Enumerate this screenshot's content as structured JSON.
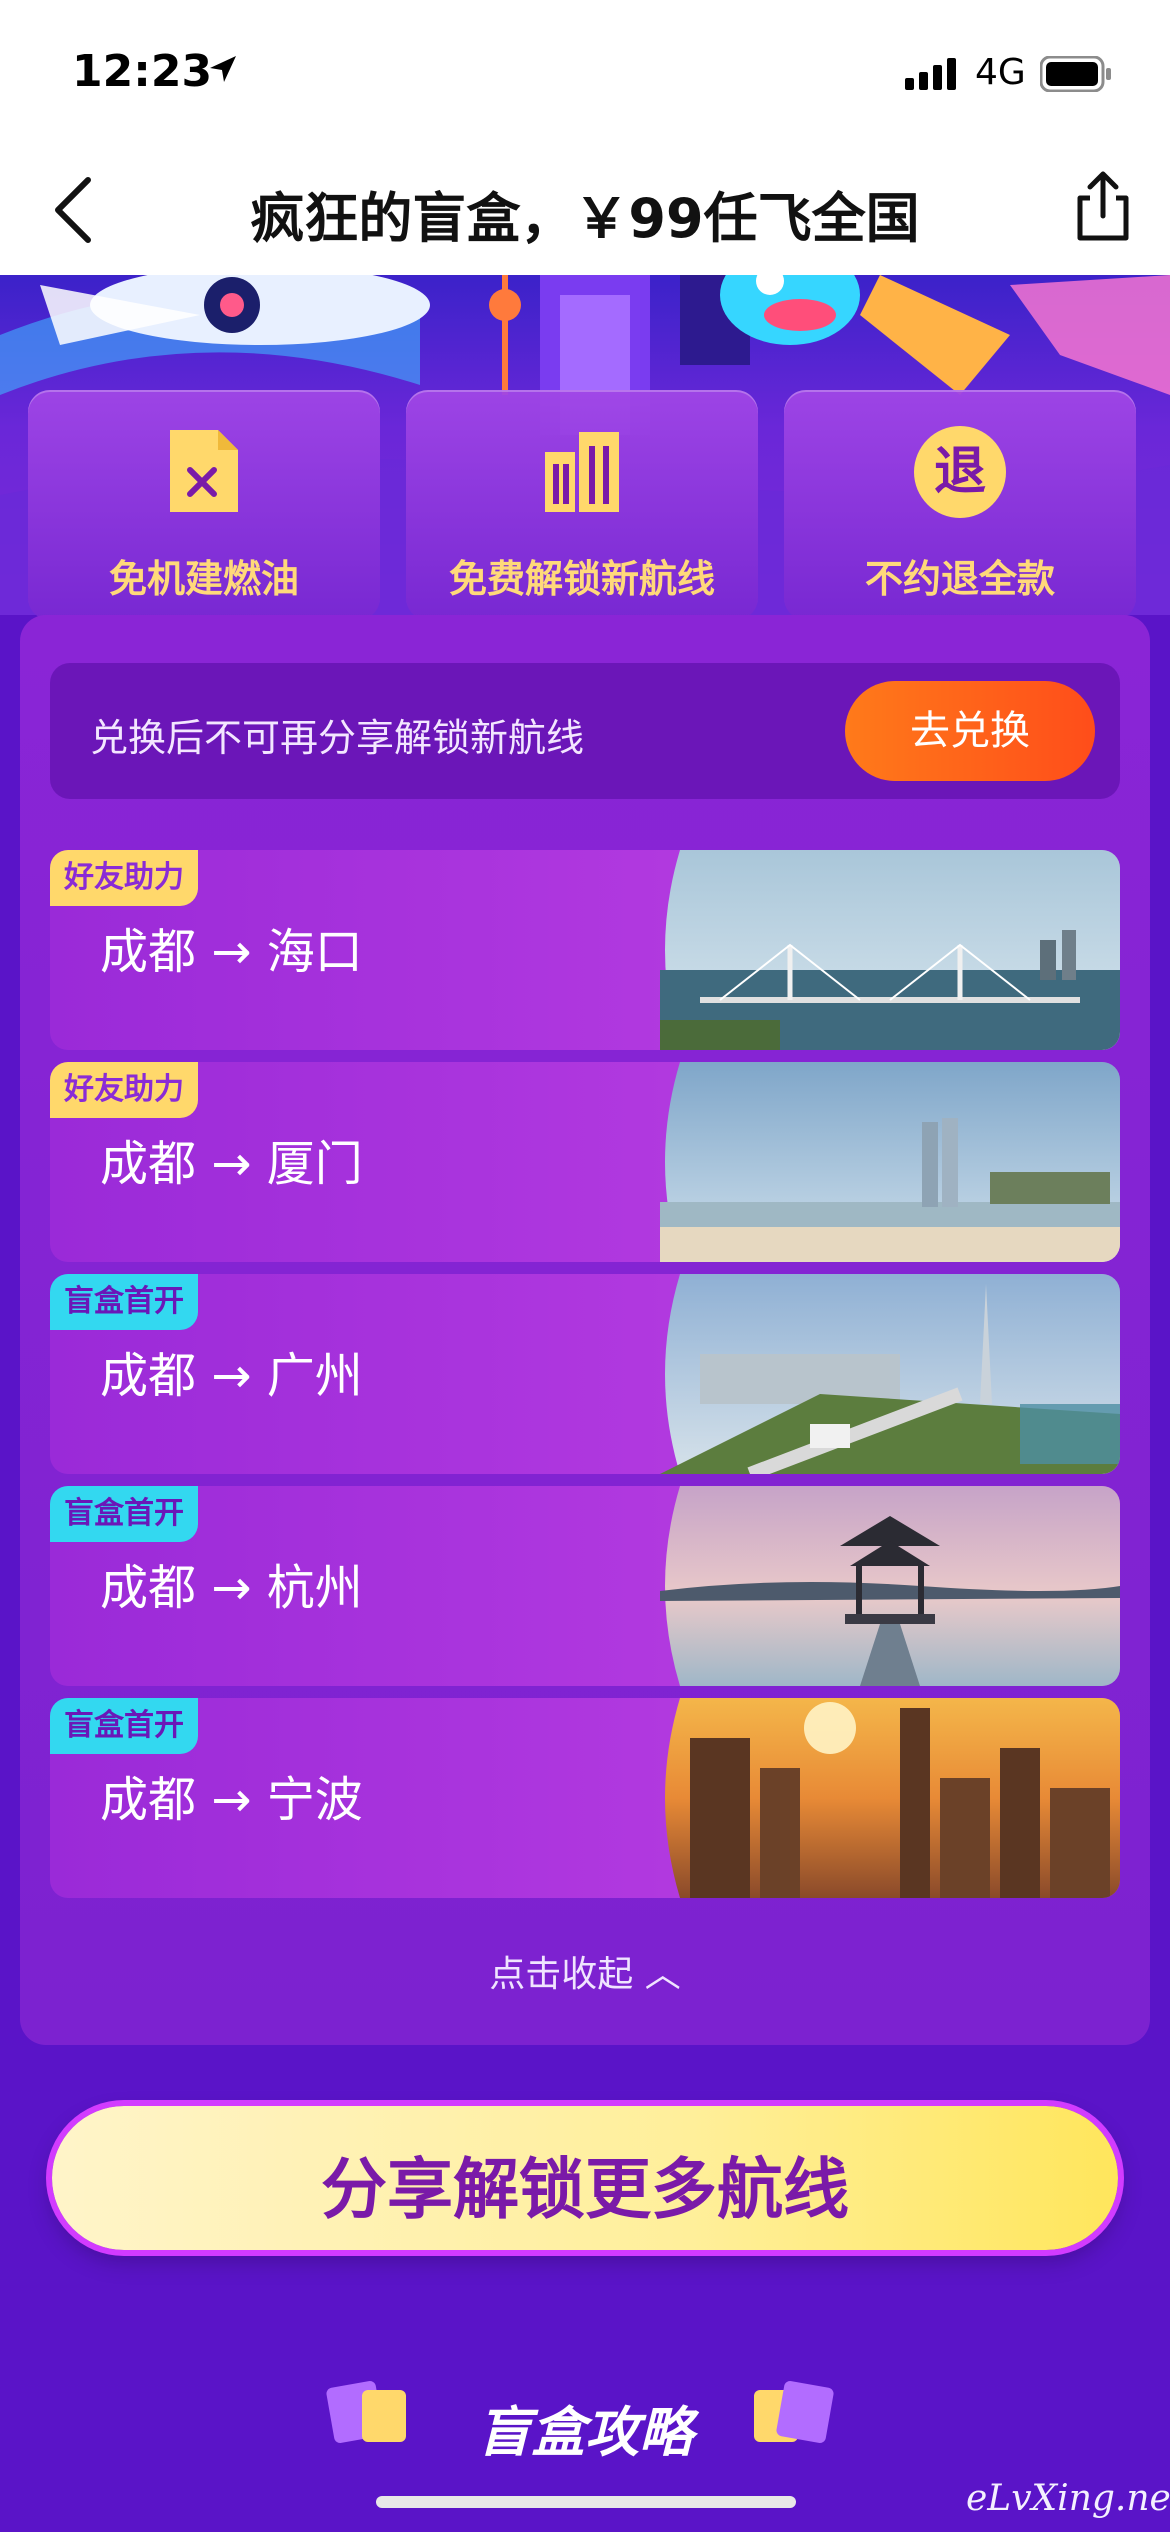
{
  "status": {
    "time": "12:23",
    "network": "4G"
  },
  "nav": {
    "title": "疯狂的盲盒，￥99任飞全国"
  },
  "features": [
    {
      "label": "免机建燃油",
      "icon": "fuel-fee-icon"
    },
    {
      "label": "免费解锁新航线",
      "icon": "building-icon"
    },
    {
      "label": "不约退全款",
      "icon": "refund-icon",
      "icon_text": "退"
    }
  ],
  "redeem": {
    "text": "兑换后不可再分享解锁新航线",
    "button": "去兑换"
  },
  "routes": [
    {
      "tag": "好友助力",
      "route": "成都 → 海口",
      "photo": "bridge-photo"
    },
    {
      "tag": "好友助力",
      "route": "成都 → 厦门",
      "photo": "twin-towers-photo"
    },
    {
      "tag": "盲盒首开",
      "route": "成都 → 广州",
      "photo": "canton-tower-photo"
    },
    {
      "tag": "盲盒首开",
      "route": "成都 → 杭州",
      "photo": "pavilion-lake-photo"
    },
    {
      "tag": "盲盒首开",
      "route": "成都 → 宁波",
      "photo": "city-sunset-photo"
    }
  ],
  "collapse": {
    "label": "点击收起 ︿"
  },
  "cta": {
    "label": "分享解锁更多航线"
  },
  "guide": {
    "title": "盲盒攻略"
  },
  "watermark": "eLvXing.net",
  "colors": {
    "primary": "#7c22d0",
    "accent_orange": "#ff5a1a",
    "tag_yellow": "#ffd86b",
    "tag_cyan": "#33d8f0"
  }
}
